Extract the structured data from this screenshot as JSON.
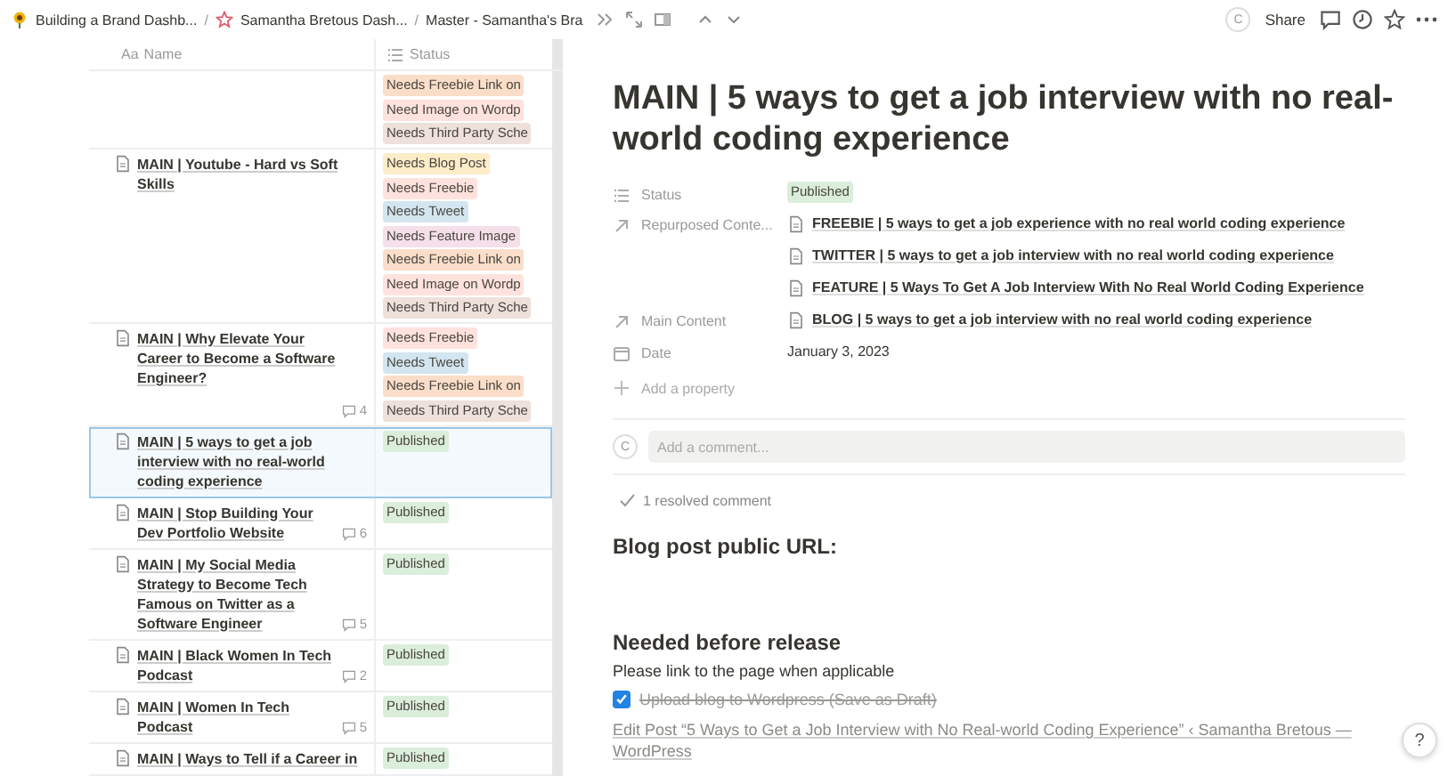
{
  "breadcrumbs": [
    {
      "label": "Building a Brand Dashb..."
    },
    {
      "separator": "/",
      "label": "Samantha Bretous Dash..."
    },
    {
      "separator": "/",
      "label": "Master - Samantha's Bra"
    }
  ],
  "topbar": {
    "avatar": "C",
    "share": "Share"
  },
  "table": {
    "columns": [
      {
        "prefix": "Aa",
        "label": "Name"
      },
      {
        "label": "Status"
      }
    ],
    "rows": [
      {
        "name": "",
        "comments": "",
        "selected": false,
        "tags": [
          {
            "label": "Needs Freebie Link on",
            "color": "#fadec9"
          },
          {
            "label": "Need Image on Wordp",
            "color": "#ffe2dd"
          },
          {
            "label": "Needs Third Party Sche",
            "color": "#eee0da"
          }
        ]
      },
      {
        "name": "MAIN | Youtube - Hard vs Soft Skills",
        "comments": "",
        "selected": false,
        "tags": [
          {
            "label": "Needs Blog Post",
            "color": "#fdecc8"
          },
          {
            "label": "Needs Freebie",
            "color": "#ffe2dd"
          },
          {
            "label": "Needs Tweet",
            "color": "#d3e5ef"
          },
          {
            "label": "Needs Feature Image",
            "color": "#f5e0e9"
          },
          {
            "label": "Needs Freebie Link on",
            "color": "#fadec9"
          },
          {
            "label": "Need Image on Wordp",
            "color": "#ffe2dd"
          },
          {
            "label": "Needs Third Party Sche",
            "color": "#eee0da"
          }
        ]
      },
      {
        "name": "MAIN | Why Elevate Your Career to Become a Software Engineer?",
        "comments": "4",
        "selected": false,
        "tags": [
          {
            "label": "Needs Freebie",
            "color": "#ffe2dd"
          },
          {
            "label": "Needs Tweet",
            "color": "#d3e5ef"
          },
          {
            "label": "Needs Freebie Link on",
            "color": "#fadec9"
          },
          {
            "label": "Needs Third Party Sche",
            "color": "#eee0da"
          }
        ]
      },
      {
        "name": "MAIN | 5 ways to get a job interview with no real-world coding experience",
        "comments": "",
        "selected": true,
        "tags": [
          {
            "label": "Published",
            "color": "#dbeddb"
          }
        ]
      },
      {
        "name": "MAIN | Stop Building Your Dev Portfolio Website",
        "comments": "6",
        "selected": false,
        "tags": [
          {
            "label": "Published",
            "color": "#dbeddb"
          }
        ]
      },
      {
        "name": "MAIN | My Social Media Strategy to Become Tech Famous on Twitter as a Software Engineer",
        "comments": "5",
        "selected": false,
        "tags": [
          {
            "label": "Published",
            "color": "#dbeddb"
          }
        ]
      },
      {
        "name": "MAIN | Black Women In Tech Podcast",
        "comments": "2",
        "selected": false,
        "tags": [
          {
            "label": "Published",
            "color": "#dbeddb"
          }
        ]
      },
      {
        "name": "MAIN | Women In Tech Podcast",
        "comments": "5",
        "selected": false,
        "tags": [
          {
            "label": "Published",
            "color": "#dbeddb"
          }
        ]
      },
      {
        "name": "MAIN | Ways to Tell if a Career in",
        "comments": "",
        "selected": false,
        "tags": [
          {
            "label": "Published",
            "color": "#dbeddb"
          }
        ]
      }
    ]
  },
  "page": {
    "title": "MAIN | 5 ways to get a job interview with no real-world coding experience",
    "properties": [
      {
        "kind": "status",
        "label": "Status",
        "values": [
          "Published"
        ]
      },
      {
        "kind": "relation",
        "label": "Repurposed Conte...",
        "values": [
          "FREEBIE | 5 ways to get a job experience with no real world coding experience",
          "TWITTER | 5 ways to get a job interview with no real world coding experience",
          "FEATURE | 5 Ways To Get A Job Interview With No Real World Coding Experience"
        ]
      },
      {
        "kind": "relation",
        "label": "Main Content",
        "values": [
          "BLOG | 5 ways to get a job interview with no real world coding experience"
        ]
      },
      {
        "kind": "date",
        "label": "Date",
        "values": [
          "January 3, 2023"
        ]
      }
    ],
    "add_property": "Add a property",
    "comment": {
      "avatar": "C",
      "placeholder": "Add a comment..."
    },
    "resolved": "1 resolved comment",
    "blocks": [
      {
        "kind": "heading",
        "text": "Blog post public URL:"
      },
      {
        "kind": "spacer"
      },
      {
        "kind": "heading",
        "text": "Needed before release"
      },
      {
        "kind": "paragraph",
        "text": "Please link to the page when applicable"
      },
      {
        "kind": "todo",
        "text": "Upload blog to Wordpress (Save as Draft)",
        "checked": true
      },
      {
        "kind": "link",
        "text": "Edit Post “5 Ways to Get a Job Interview with No Real-world Coding Experience” ‹ Samantha Bretous — WordPress"
      }
    ]
  },
  "help": "?"
}
